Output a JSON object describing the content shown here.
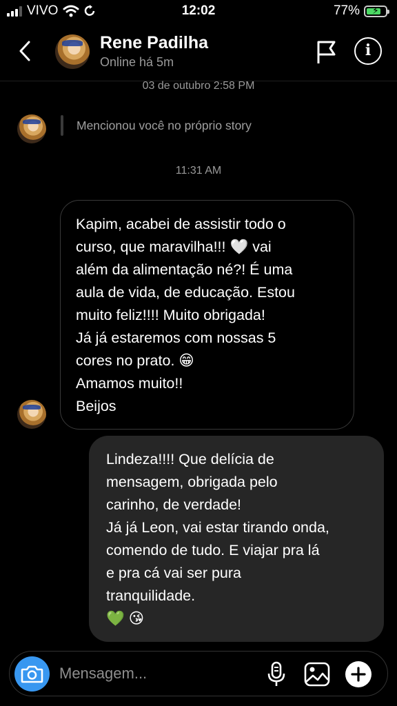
{
  "status_bar": {
    "carrier": "VIVO",
    "time": "12:02",
    "battery_percent": "77%",
    "battery_level": 0.77,
    "battery_color": "#4cd964"
  },
  "header": {
    "name": "Rene Padilha",
    "status": "Online há 5m",
    "icons": [
      "back-chevron-icon",
      "avatar",
      "flag-icon",
      "info-icon"
    ]
  },
  "chat": {
    "timestamp_1": "03 de outubro 2:58 PM",
    "story_mention": "Mencionou você no próprio story",
    "timestamp_2": "11:31 AM",
    "incoming_message": "Kapim, acabei de assistir todo o\ncurso, que maravilha!!! 🤍 vai\nalém da alimentação né?! É uma\naula de vida, de educação.  Estou\nmuito feliz!!!! Muito obrigada!\nJá já estaremos com nossas 5\ncores no prato. 😁\nAmamos muito!!\nBeijos",
    "outgoing_message": "Lindeza!!!! Que delícia de\nmensagem, obrigada pelo\ncarinho, de verdade!\nJá já Leon, vai estar tirando onda,\ncomendo de tudo. E viajar pra lá\ne pra cá vai ser pura\ntranquilidade.\n💚 😘"
  },
  "composer": {
    "placeholder": "Mensagem...",
    "icons": [
      "camera-icon",
      "microphone-icon",
      "gallery-icon",
      "plus-icon"
    ],
    "camera_color": "#3897f0"
  }
}
